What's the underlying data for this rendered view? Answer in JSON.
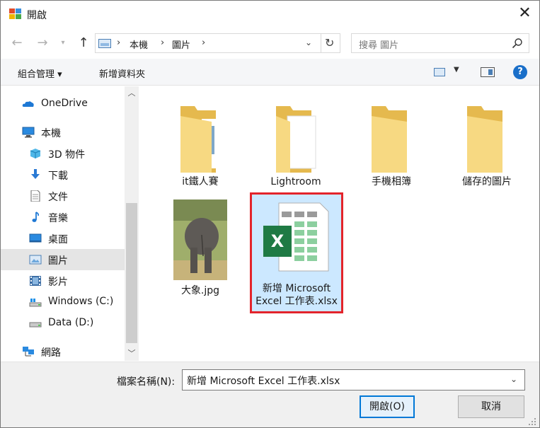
{
  "window": {
    "title": "開啟"
  },
  "address": {
    "crumbs": [
      "本機",
      "圖片"
    ],
    "search_placeholder": "搜尋 圖片"
  },
  "commands": {
    "organize": "組合管理 ▾",
    "new_folder": "新增資料夾"
  },
  "sidebar": {
    "items": [
      {
        "label": "OneDrive",
        "icon": "onedrive-icon"
      },
      {
        "label": "本機",
        "icon": "this-pc-icon"
      },
      {
        "label": "3D 物件",
        "icon": "3d-objects-icon"
      },
      {
        "label": "下載",
        "icon": "download-icon"
      },
      {
        "label": "文件",
        "icon": "documents-icon"
      },
      {
        "label": "音樂",
        "icon": "music-icon"
      },
      {
        "label": "桌面",
        "icon": "desktop-icon"
      },
      {
        "label": "圖片",
        "icon": "pictures-icon",
        "selected": true
      },
      {
        "label": "影片",
        "icon": "videos-icon"
      },
      {
        "label": "Windows (C:)",
        "icon": "drive-c-icon"
      },
      {
        "label": "Data (D:)",
        "icon": "drive-d-icon"
      },
      {
        "label": "網路",
        "icon": "network-icon"
      }
    ]
  },
  "files": [
    {
      "name": "it鐵人賽",
      "type": "folder"
    },
    {
      "name": "Lightroom",
      "type": "folder"
    },
    {
      "name": "手機相簿",
      "type": "folder"
    },
    {
      "name": "儲存的圖片",
      "type": "folder"
    },
    {
      "name": "大象.jpg",
      "type": "image"
    },
    {
      "name_line1": "新增 Microsoft",
      "name_line2": "Excel 工作表.xlsx",
      "type": "excel",
      "selected": true
    }
  ],
  "footer": {
    "filename_label": "檔案名稱(N):",
    "filename_value": "新增 Microsoft Excel 工作表.xlsx",
    "open_button": "開啟(O)",
    "cancel_button": "取消"
  },
  "colors": {
    "accent": "#0078d7",
    "selection_bg": "#cce8ff",
    "highlight_border": "#e3242b",
    "folder": "#f7d982"
  }
}
